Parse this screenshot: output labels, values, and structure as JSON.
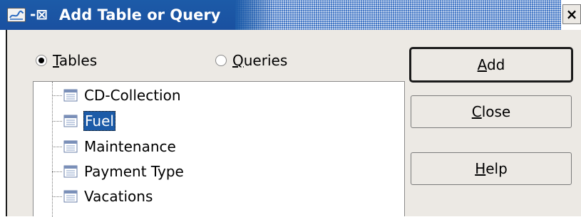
{
  "titlebar": {
    "title": "Add Table or Query",
    "app_icon": "dialog-window-icon",
    "pin_glyph": "-⊠",
    "close_glyph": "×"
  },
  "source": {
    "tables_label": "Tables",
    "queries_label": "Queries",
    "selected": "Tables"
  },
  "list": {
    "items": [
      {
        "label": "CD-Collection",
        "selected": false
      },
      {
        "label": "Fuel",
        "selected": true
      },
      {
        "label": "Maintenance",
        "selected": false
      },
      {
        "label": "Payment Type",
        "selected": false
      },
      {
        "label": "Vacations",
        "selected": false
      }
    ]
  },
  "buttons": {
    "add": "Add",
    "close": "Close",
    "help": "Help"
  },
  "colors": {
    "title_bar": "#1c5ba8",
    "selection": "#1c5ba8",
    "dialog_bg": "#ece9e4"
  }
}
